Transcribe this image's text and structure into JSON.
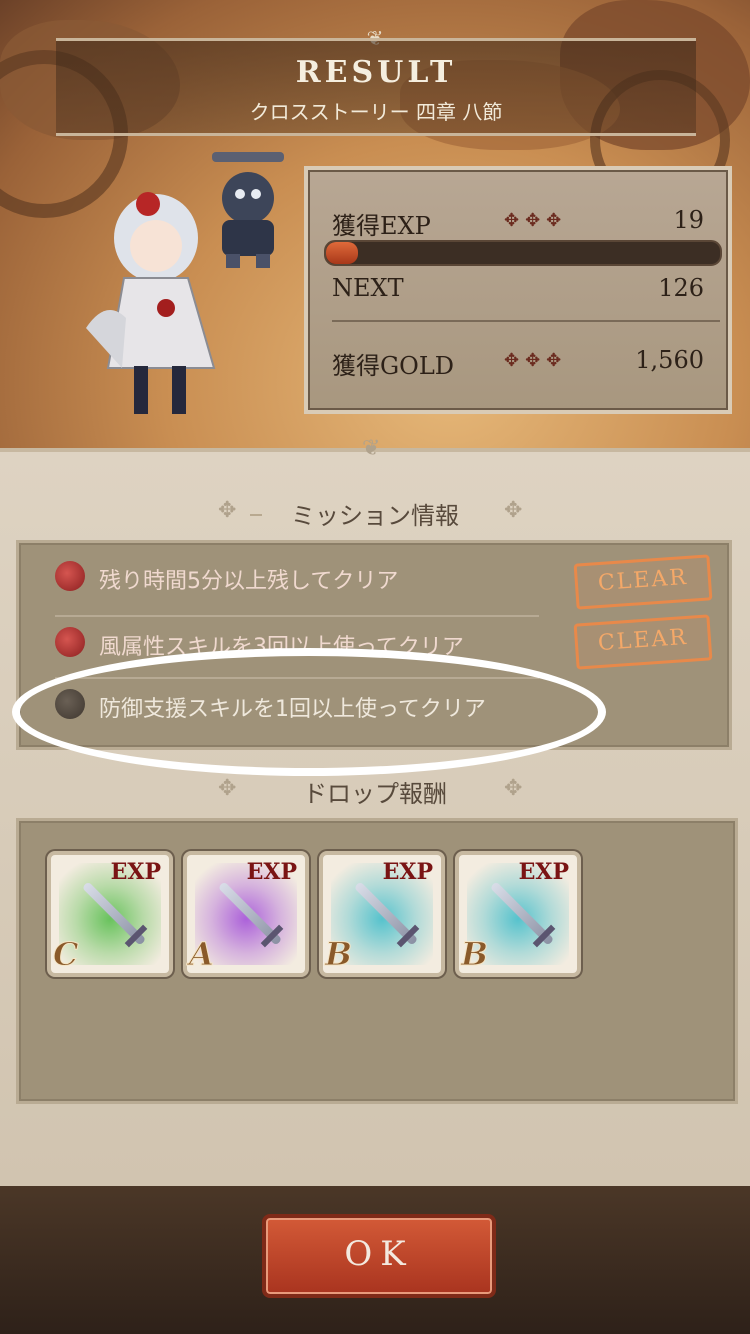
{
  "header": {
    "title": "RESULT",
    "subtitle": "クロスストーリー 四章 八節"
  },
  "stats": {
    "exp_label": "獲得EXP",
    "exp_value": "19",
    "exp_progress": 0.08,
    "next_label": "NEXT",
    "next_value": "126",
    "gold_label": "獲得GOLD",
    "gold_value": "1,560",
    "dots": "✥✥✥"
  },
  "missions": {
    "title": "ミッション情報",
    "items": [
      {
        "text": "残り時間5分以上残してクリア",
        "status": "CLEAR"
      },
      {
        "text": "風属性スキルを3回以上使ってクリア",
        "status": "CLEAR"
      },
      {
        "text": "防御支援スキルを1回以上使ってクリア",
        "status": ""
      }
    ]
  },
  "drops": {
    "title": "ドロップ報酬",
    "items": [
      {
        "tag": "EXP",
        "rank": "C",
        "color": "#46b83c"
      },
      {
        "tag": "EXP",
        "rank": "A",
        "color": "#9a3fd8"
      },
      {
        "tag": "EXP",
        "rank": "B",
        "color": "#2fb8c8"
      },
      {
        "tag": "EXP",
        "rank": "B",
        "color": "#2fb8c8"
      }
    ]
  },
  "ok_button": "OK"
}
